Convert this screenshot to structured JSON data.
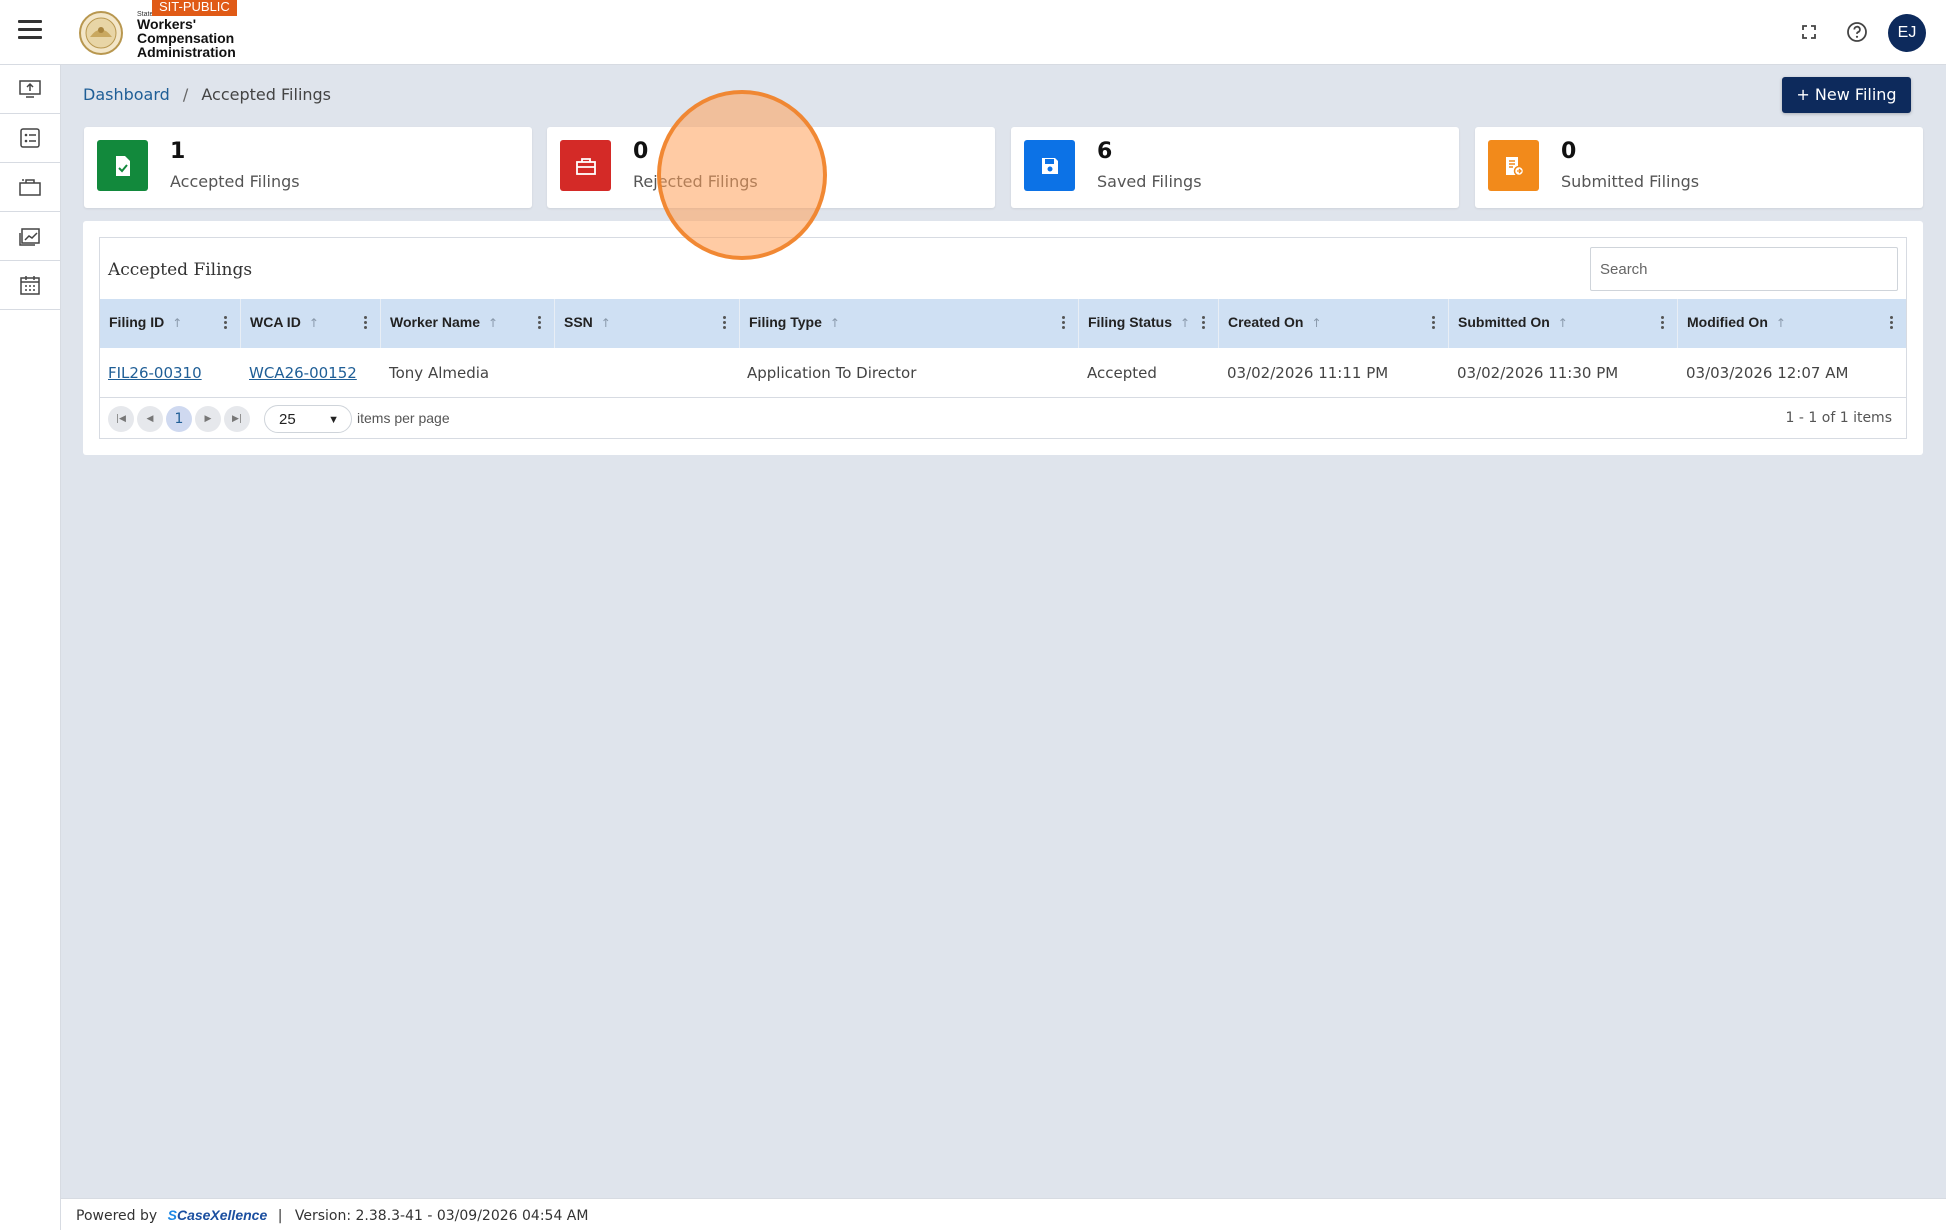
{
  "header": {
    "env_badge": "SIT-PUBLIC",
    "logo_small": "State",
    "org_line1": "Workers'",
    "org_line2": "Compensation",
    "org_line3": "Administration",
    "user_initials": "EJ"
  },
  "sidebar": {
    "items": [
      {
        "icon": "monitor-upload-icon"
      },
      {
        "icon": "list-icon"
      },
      {
        "icon": "briefcase-icon"
      },
      {
        "icon": "chart-icon"
      },
      {
        "icon": "calendar-icon"
      }
    ]
  },
  "breadcrumb": {
    "root": "Dashboard",
    "separator": "/",
    "current": "Accepted Filings"
  },
  "actions": {
    "new_filing": "+ New Filing"
  },
  "cards": [
    {
      "count": "1",
      "label": "Accepted Filings",
      "color": "#12893c",
      "icon": "document-check-icon"
    },
    {
      "count": "0",
      "label": "Rejected Filings",
      "color": "#d42a27",
      "icon": "briefcase-icon"
    },
    {
      "count": "6",
      "label": "Saved Filings",
      "color": "#0c72e6",
      "icon": "save-icon"
    },
    {
      "count": "0",
      "label": "Submitted Filings",
      "color": "#f28a1b",
      "icon": "document-submit-icon"
    }
  ],
  "grid": {
    "title": "Accepted Filings",
    "search_placeholder": "Search",
    "columns": [
      "Filing ID",
      "WCA ID",
      "Worker Name",
      "SSN",
      "Filing Type",
      "Filing Status",
      "Created On",
      "Submitted On",
      "Modified On"
    ],
    "rows": [
      {
        "filing_id": "FIL26-00310",
        "wca_id": "WCA26-00152",
        "worker_name": "Tony Almedia",
        "ssn": "",
        "filing_type": "Application To Director",
        "filing_status": "Accepted",
        "created_on": "03/02/2026 11:11 PM",
        "submitted_on": "03/02/2026 11:30 PM",
        "modified_on": "03/03/2026 12:07 AM"
      }
    ],
    "pager": {
      "current_page": "1",
      "page_size": "25",
      "items_per_page_label": "items per page",
      "info": "1 - 1 of 1 items"
    }
  },
  "footer": {
    "powered_by": "Powered by",
    "brand": "CaseXellence",
    "separator": "|",
    "version": "Version: 2.38.3-41 - 03/09/2026 04:54 AM"
  },
  "colors": {
    "primary": "#0d2a5c",
    "link": "#1f5e96",
    "header_row": "#cfe0f3",
    "background": "#dfe4ec"
  }
}
